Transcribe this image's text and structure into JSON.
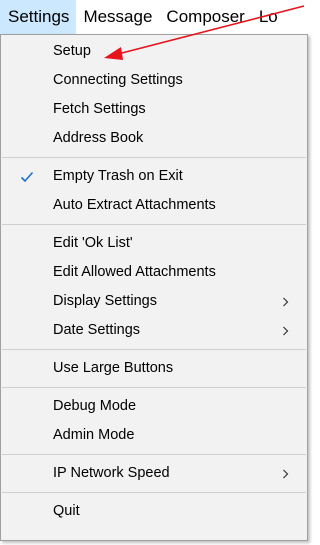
{
  "menubar": {
    "items": [
      {
        "label": "Settings"
      },
      {
        "label": "Message"
      },
      {
        "label": "Composer"
      },
      {
        "label": "Lo"
      }
    ]
  },
  "dropdown": {
    "items": [
      {
        "label": "Setup"
      },
      {
        "label": "Connecting Settings"
      },
      {
        "label": "Fetch Settings"
      },
      {
        "label": "Address Book"
      },
      {
        "label": "Empty Trash on Exit",
        "checked": true
      },
      {
        "label": "Auto Extract Attachments"
      },
      {
        "label": "Edit 'Ok List'"
      },
      {
        "label": "Edit Allowed Attachments"
      },
      {
        "label": "Display Settings",
        "submenu": true
      },
      {
        "label": "Date Settings",
        "submenu": true
      },
      {
        "label": "Use Large Buttons"
      },
      {
        "label": "Debug Mode"
      },
      {
        "label": "Admin Mode"
      },
      {
        "label": "IP Network Speed",
        "submenu": true
      },
      {
        "label": "Quit"
      }
    ]
  },
  "annotation": {
    "arrow_color": "#e8141b",
    "points_to": "Setup"
  },
  "colors": {
    "menubar_active": "#cce8ff",
    "menu_background": "#f2f2f2",
    "check_color": "#1e6fd0"
  }
}
